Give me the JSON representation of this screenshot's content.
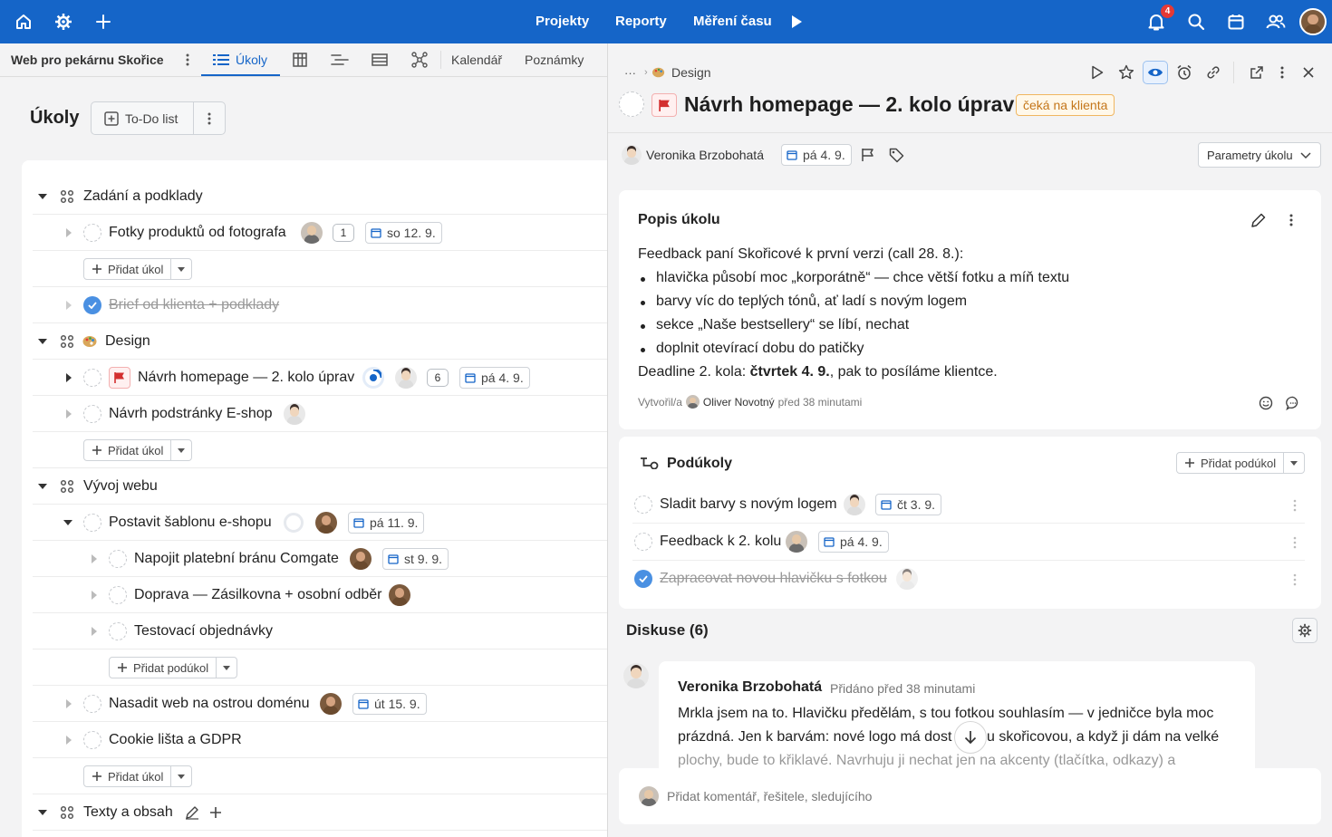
{
  "topbar": {
    "nav": [
      "Projekty",
      "Reporty",
      "Měření času"
    ],
    "notifications_count": "4",
    "icons": [
      "home-icon",
      "gear-icon",
      "plus-icon",
      "play-icon",
      "bell-icon",
      "search-icon",
      "calendar-icon",
      "team-icon",
      "user-avatar"
    ]
  },
  "left": {
    "project_name": "Web pro pekárnu Skořice",
    "tabs": [
      "Úkoly",
      "Kalendář",
      "Poznámky"
    ],
    "active_tab": "Úkoly",
    "page_title": "Úkoly",
    "view_button": "To-Do list",
    "add_task": "Přidat úkol",
    "add_subtask": "Přidat podúkol",
    "groups": [
      {
        "name": "Zadání a podklady"
      },
      {
        "name": "Design"
      },
      {
        "name": "Vývoj webu"
      },
      {
        "name": "Texty a obsah"
      }
    ],
    "tasks": {
      "t1": {
        "title": "Fotky produktů od fotografa",
        "comments": "1",
        "due": "so 12. 9."
      },
      "t2": {
        "title": "Brief od klienta + podklady",
        "done": true
      },
      "t3": {
        "title": "Návrh homepage — 2. kolo úprav",
        "comments": "6",
        "due": "pá 4. 9."
      },
      "t4": {
        "title": "Návrh podstránky E-shop"
      },
      "t5": {
        "title": "Postavit šablonu e-shopu",
        "due": "pá 11. 9."
      },
      "t6": {
        "title": "Napojit platební bránu Comgate",
        "due": "st 9. 9."
      },
      "t7": {
        "title": "Doprava — Zásilkovna + osobní odběr"
      },
      "t8": {
        "title": "Testovací objednávky"
      },
      "t9": {
        "title": "Nasadit web na ostrou doménu",
        "due": "út 15. 9."
      },
      "t10": {
        "title": "Cookie lišta a GDPR"
      }
    }
  },
  "detail": {
    "breadcrumb_ellipsis": "···",
    "breadcrumb": "Design",
    "title": "Návrh homepage — 2. kolo úprav",
    "status": "čeká na klienta",
    "assignee": "Veronika Brzobohatá",
    "due": "pá 4. 9.",
    "params_button": "Parametry úkolu",
    "description": {
      "heading": "Popis úkolu",
      "intro": "Feedback paní Skořicové k první verzi (call 28. 8.):",
      "bullets": [
        "hlavička působí moc „korporátně“ — chce větší fotku a míň textu",
        "barvy víc do teplých tónů, ať ladí s novým logem",
        "sekce „Naše bestsellery“ se líbí, nechat",
        "doplnit otevírací dobu do patičky"
      ],
      "deadline_prefix": "Deadline 2. kola: ",
      "deadline_bold": "čtvrtek 4. 9.",
      "deadline_suffix": ", pak to posíláme klientce.",
      "created_label": "Vytvořil/a",
      "created_by": "Oliver Novotný",
      "created_when": "před 38 minutami"
    },
    "subtasks": {
      "heading": "Podúkoly",
      "add_button": "Přidat podúkol",
      "items": [
        {
          "title": "Sladit barvy s novým logem",
          "due": "čt 3. 9."
        },
        {
          "title": "Feedback k 2. kolu",
          "due": "pá 4. 9."
        },
        {
          "title": "Zapracovat novou hlavičku s fotkou",
          "done": true
        }
      ]
    },
    "discussion": {
      "heading": "Diskuse (6)",
      "comment_author": "Veronika Brzobohatá",
      "comment_time": "Přidáno před 38 minutami",
      "comment_line1": "Mrkla jsem na to. Hlavičku předělám, s tou fotkou souhlasím — v jedničce byla moc",
      "comment_line2a": "prázdná. Jen k barvám: nové logo má dost",
      "comment_line2b": "u skořicovou, a když ji dám na velké",
      "comment_line3": "plochy, bude to křiklavé. Navrhuju ji nechat jen na akcenty (tlačítka, odkazy) a",
      "input_placeholder": "Přidat komentář, řešitele, sledujícího"
    }
  },
  "colors": {
    "brand": "#1565c8",
    "flag": "#e53935",
    "status_border": "#f0b660",
    "check": "#4a90e2"
  }
}
